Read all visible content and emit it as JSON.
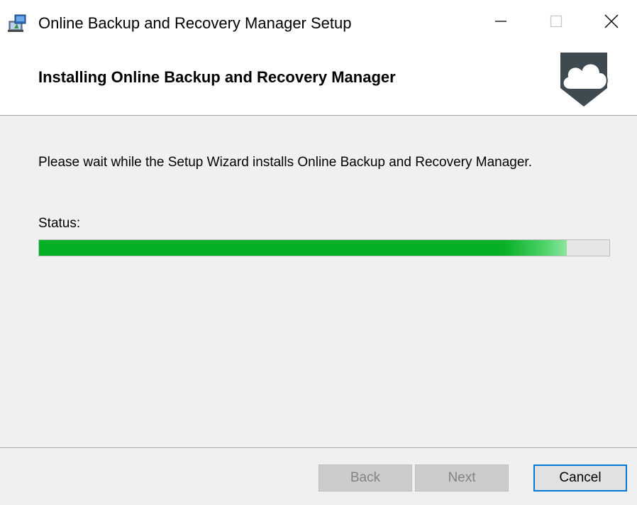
{
  "window": {
    "title": "Online Backup and Recovery Manager Setup"
  },
  "header": {
    "title": "Installing Online Backup and Recovery Manager"
  },
  "body": {
    "message": "Please wait while the Setup Wizard installs Online Backup and Recovery Manager.",
    "status_label": "Status:",
    "progress_fraction": 0.925,
    "progress_color": "#06b025"
  },
  "buttons": {
    "back": "Back",
    "next": "Next",
    "cancel": "Cancel"
  },
  "icons": {
    "app": "installer-icon",
    "logo": "cloud-shield-logo",
    "minimize": "minimize-icon",
    "maximize": "maximize-icon",
    "close": "close-icon"
  },
  "colors": {
    "accent": "#0078d7",
    "window_bg": "#f0f0f0",
    "logo_dark": "#3e4a4f"
  }
}
